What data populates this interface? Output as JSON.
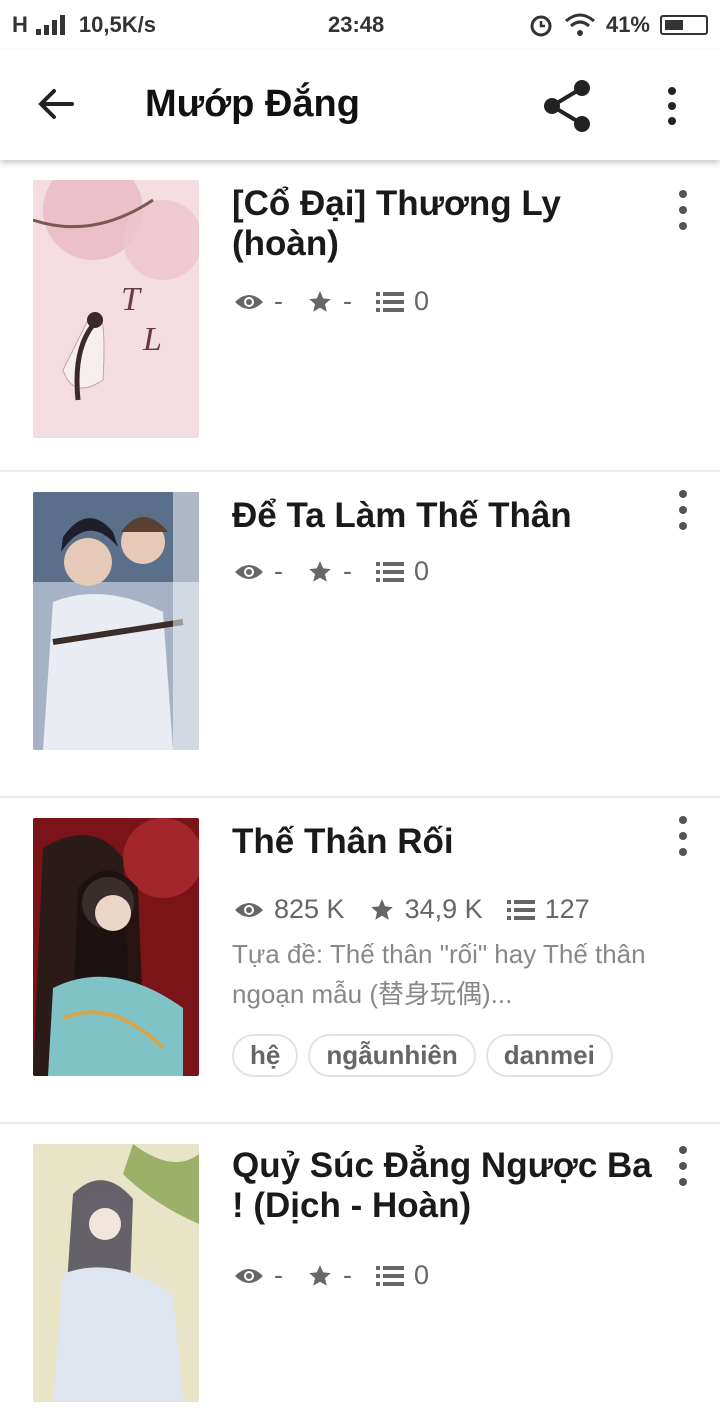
{
  "status_bar": {
    "network": "H",
    "speed": "10,5K/s",
    "time": "23:48",
    "battery": "41%"
  },
  "app_bar": {
    "title": "Mướp Đắng"
  },
  "stories": [
    {
      "title": "[Cổ Đại] Thương Ly (hoàn)",
      "views": "-",
      "votes": "-",
      "chapters": "0",
      "cover_colors": [
        "#f3dde0",
        "#e8b9c4",
        "#c9a0ae"
      ]
    },
    {
      "title": "Để Ta Làm Thế Thân",
      "views": "-",
      "votes": "-",
      "chapters": "0",
      "cover_colors": [
        "#5a6f8a",
        "#a7b3c4",
        "#3b2e2a"
      ]
    },
    {
      "title": "Thế Thân Rối",
      "views": "825 K",
      "votes": "34,9 K",
      "chapters": "127",
      "description": "Tựa đề: Thế thân \"rối\" hay Thế thân ngoạn mẫu (替身玩偶)...",
      "tags": [
        "hệ",
        "ngẫunhiên",
        "danmei"
      ],
      "cover_colors": [
        "#7a1418",
        "#2a1a18",
        "#7fc3c7"
      ]
    },
    {
      "title": "Quỷ Súc Đẳng Ngược Ba ! (Dịch - Hoàn)",
      "views": "-",
      "votes": "-",
      "chapters": "0",
      "cover_colors": [
        "#e8e4c8",
        "#9db06a",
        "#4d4a57"
      ]
    }
  ]
}
